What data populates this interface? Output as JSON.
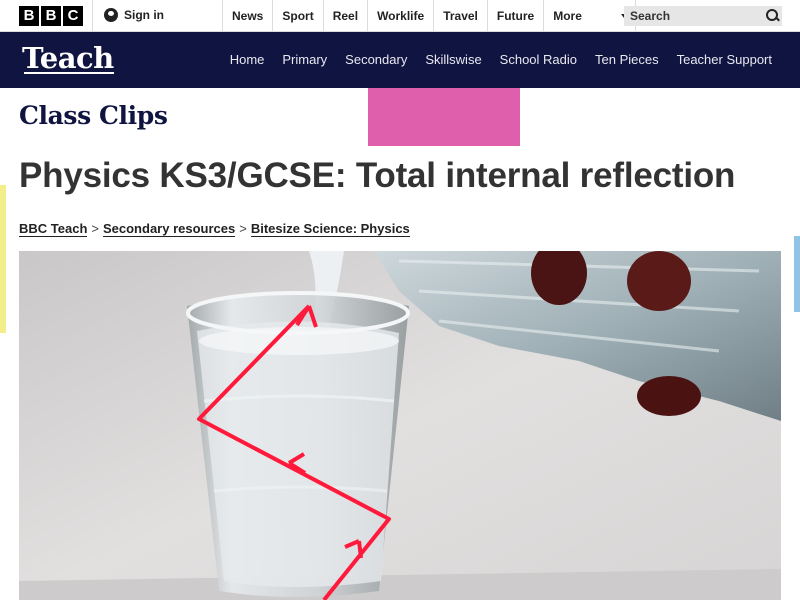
{
  "bbc_logo": [
    "B",
    "B",
    "C"
  ],
  "signin": {
    "label": "Sign in",
    "icon": "user-icon"
  },
  "top_nav": [
    "News",
    "Sport",
    "Reel",
    "Worklife",
    "Travel",
    "Future",
    "More"
  ],
  "search": {
    "placeholder": "Search",
    "icon": "search-icon"
  },
  "teach": {
    "logo": "Teach",
    "nav": [
      "Home",
      "Primary",
      "Secondary",
      "Skillswise",
      "School Radio",
      "Ten Pieces",
      "Teacher Support"
    ]
  },
  "section_title": "Class Clips",
  "page_title": "Physics KS3/GCSE: Total internal reflection",
  "breadcrumb": [
    "BBC Teach",
    "Secondary resources",
    "Bitesize Science: Physics"
  ],
  "breadcrumb_separator": ">",
  "colors": {
    "teach_bar": "#101441",
    "accent_pink": "#e05fad",
    "accent_yellow": "#f2ee8a",
    "accent_blue": "#8fc4e6",
    "ray": "#ff1a3c"
  }
}
